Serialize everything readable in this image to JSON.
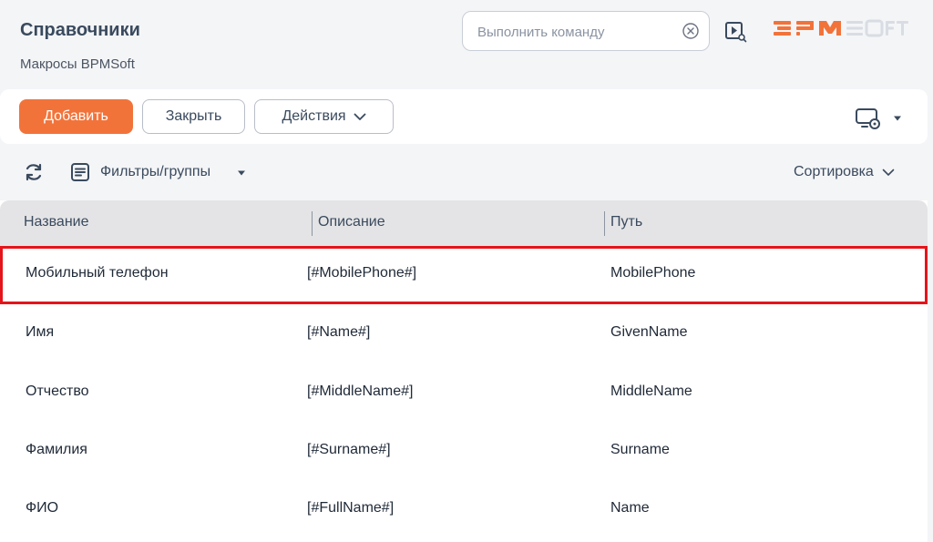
{
  "header": {
    "title": "Справочники",
    "subtitle": "Макросы BPMSoft",
    "command_placeholder": "Выполнить команду",
    "brand_color": "#f2733a"
  },
  "toolbar": {
    "add_label": "Добавить",
    "close_label": "Закрыть",
    "actions_label": "Действия"
  },
  "filters": {
    "filter_label": "Фильтры/группы",
    "sort_label": "Сортировка"
  },
  "grid": {
    "columns": [
      "Название",
      "Описание",
      "Путь"
    ],
    "rows": [
      {
        "name": "Мобильный телефон",
        "description": "[#MobilePhone#]",
        "path": "MobilePhone",
        "selected": true
      },
      {
        "name": "Имя",
        "description": "[#Name#]",
        "path": "GivenName",
        "selected": false
      },
      {
        "name": "Отчество",
        "description": "[#MiddleName#]",
        "path": "MiddleName",
        "selected": false
      },
      {
        "name": "Фамилия",
        "description": "[#Surname#]",
        "path": "Surname",
        "selected": false
      },
      {
        "name": "ФИО",
        "description": "[#FullName#]",
        "path": "Name",
        "selected": false
      }
    ]
  },
  "icons": {
    "clear": "circle-x-icon",
    "video": "video-play-icon",
    "refresh": "refresh-icon",
    "filter": "filter-list-icon",
    "view_settings": "monitor-gear-icon"
  }
}
